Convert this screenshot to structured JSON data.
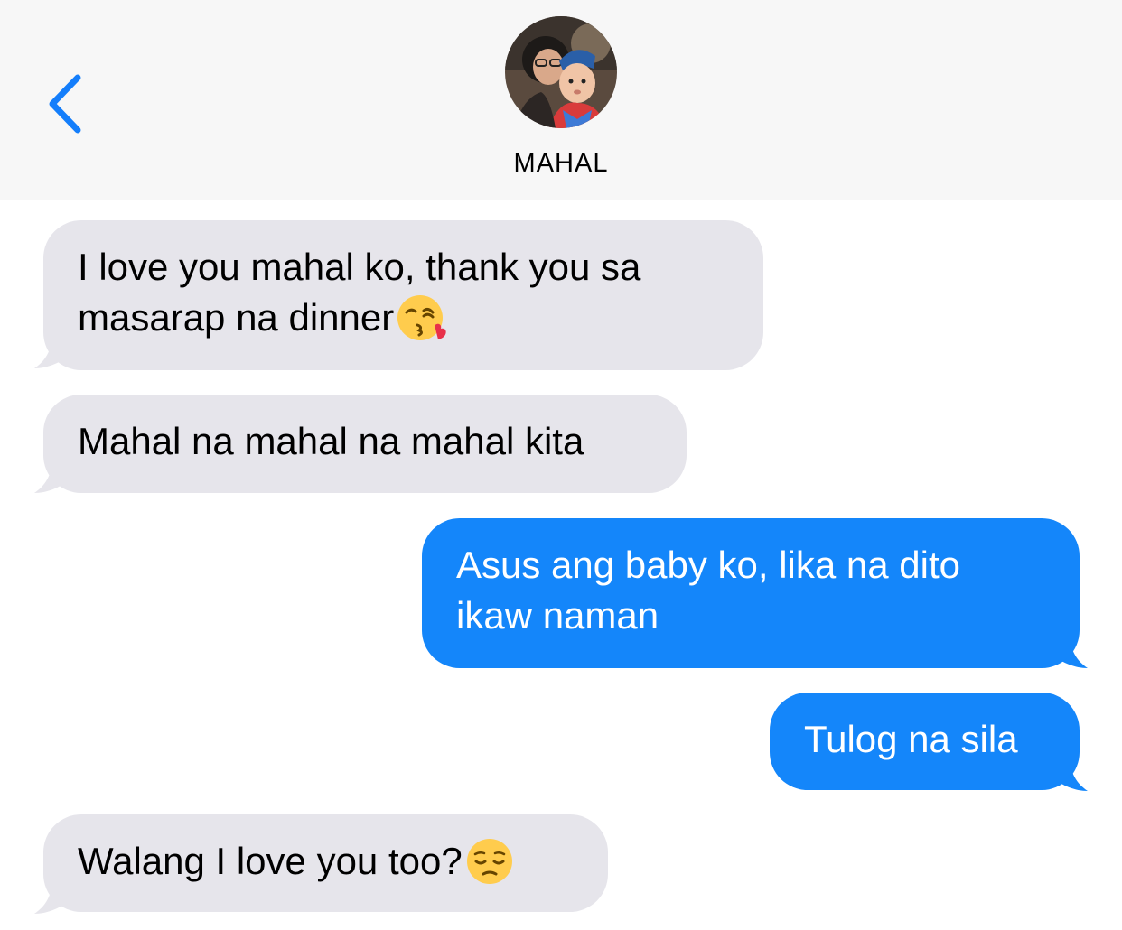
{
  "header": {
    "contact_name": "MAHAL"
  },
  "messages": [
    {
      "direction": "incoming",
      "text": "I love you mahal ko, thank you sa masarap na dinner",
      "emoji": "kissing-heart-icon"
    },
    {
      "direction": "incoming",
      "text": "Mahal na mahal na mahal kita"
    },
    {
      "direction": "outgoing",
      "text": "Asus ang baby ko, lika na dito ikaw naman"
    },
    {
      "direction": "outgoing",
      "text": "Tulog na sila"
    },
    {
      "direction": "incoming",
      "text": "Walang I love you too?",
      "emoji": "pensive-face-icon"
    }
  ],
  "colors": {
    "accent": "#147efb",
    "outgoing_bubble": "#1486fa",
    "incoming_bubble": "#e6e5eb",
    "header_bg": "#f7f7f7"
  }
}
